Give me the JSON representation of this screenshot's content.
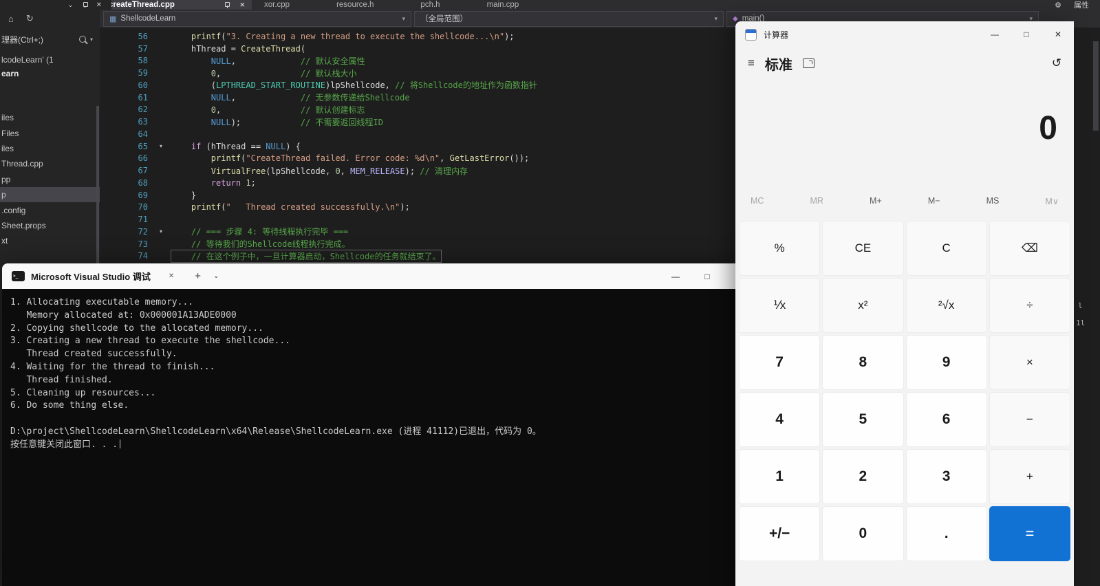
{
  "icons": {
    "chevron_down": "⌄",
    "caret": "▾",
    "close": "✕",
    "minimize": "—",
    "maximize": "□",
    "plus": "+",
    "hamburger": "≡",
    "history": "↺",
    "gear": "⚙",
    "home": "⌂",
    "refresh": "↻",
    "cmd": ">_",
    "project": "▦",
    "cube": "◆"
  },
  "vs": {
    "tabs": [
      {
        "label": "createThread.cpp",
        "active": true
      },
      {
        "label": "xor.cpp"
      },
      {
        "label": "resource.h"
      },
      {
        "label": "pch.h"
      },
      {
        "label": "main.cpp"
      }
    ],
    "top_right": {
      "properties": "属性"
    },
    "navbar": {
      "project": "ShellcodeLearn",
      "scope": "（全局范围）",
      "symbol": "main()"
    },
    "sidebar": {
      "search": "理器(Ctrl+;)",
      "solution": "lcodeLearn' (1",
      "project": "earn",
      "items": [
        {
          "label": "iles"
        },
        {
          "label": "Files"
        },
        {
          "label": "iles"
        },
        {
          "label": "Thread.cpp"
        },
        {
          "label": "pp"
        },
        {
          "label": "p",
          "selected": true
        },
        {
          "label": ".config"
        },
        {
          "label": "Sheet.props"
        },
        {
          "label": "xt"
        }
      ]
    },
    "right_strip": [
      "l",
      "1l"
    ],
    "editor": {
      "lines": [
        {
          "num": "56",
          "segs": [
            [
              "p",
              "    "
            ],
            [
              "fn",
              "printf"
            ],
            [
              "p",
              "("
            ],
            [
              "s",
              "\"3. Creating a new thread to execute the shellcode...\\n\""
            ],
            [
              "p",
              ");"
            ]
          ]
        },
        {
          "num": "57",
          "segs": [
            [
              "p",
              "    hThread = "
            ],
            [
              "fn",
              "CreateThread"
            ],
            [
              "p",
              "("
            ]
          ]
        },
        {
          "num": "58",
          "segs": [
            [
              "p",
              "        "
            ],
            [
              "k",
              "NULL"
            ],
            [
              "p",
              ",             "
            ],
            [
              "c",
              "// 默认安全属性"
            ]
          ]
        },
        {
          "num": "59",
          "segs": [
            [
              "p",
              "        "
            ],
            [
              "n",
              "0"
            ],
            [
              "p",
              ",                "
            ],
            [
              "c",
              "// 默认栈大小"
            ]
          ]
        },
        {
          "num": "60",
          "segs": [
            [
              "p",
              "        ("
            ],
            [
              "t",
              "LPTHREAD_START_ROUTINE"
            ],
            [
              "p",
              ")lpShellcode, "
            ],
            [
              "c",
              "// 将Shellcode的地址作为函数指针"
            ]
          ]
        },
        {
          "num": "61",
          "segs": [
            [
              "p",
              "        "
            ],
            [
              "k",
              "NULL"
            ],
            [
              "p",
              ",             "
            ],
            [
              "c",
              "// 无参数传递给Shellcode"
            ]
          ]
        },
        {
          "num": "62",
          "segs": [
            [
              "p",
              "        "
            ],
            [
              "n",
              "0"
            ],
            [
              "p",
              ",                "
            ],
            [
              "c",
              "// 默认创建标志"
            ]
          ]
        },
        {
          "num": "63",
          "segs": [
            [
              "p",
              "        "
            ],
            [
              "k",
              "NULL"
            ],
            [
              "p",
              ");            "
            ],
            [
              "c",
              "// 不需要返回线程ID"
            ]
          ]
        },
        {
          "num": "64",
          "segs": []
        },
        {
          "num": "65",
          "fold": true,
          "segs": [
            [
              "p",
              "    "
            ],
            [
              "ck",
              "if"
            ],
            [
              "p",
              " (hThread == "
            ],
            [
              "k",
              "NULL"
            ],
            [
              "p",
              ") {"
            ]
          ]
        },
        {
          "num": "66",
          "segs": [
            [
              "p",
              "        "
            ],
            [
              "fn",
              "printf"
            ],
            [
              "p",
              "("
            ],
            [
              "s",
              "\"CreateThread failed. Error code: %d\\n\""
            ],
            [
              "p",
              ", "
            ],
            [
              "fn",
              "GetLastError"
            ],
            [
              "p",
              "());"
            ]
          ]
        },
        {
          "num": "67",
          "segs": [
            [
              "p",
              "        "
            ],
            [
              "fn",
              "VirtualFree"
            ],
            [
              "p",
              "(lpShellcode, "
            ],
            [
              "n",
              "0"
            ],
            [
              "p",
              ", "
            ],
            [
              "m",
              "MEM_RELEASE"
            ],
            [
              "p",
              "); "
            ],
            [
              "c",
              "// 清理内存"
            ]
          ]
        },
        {
          "num": "68",
          "segs": [
            [
              "p",
              "        "
            ],
            [
              "ck",
              "return"
            ],
            [
              "p",
              " "
            ],
            [
              "n",
              "1"
            ],
            [
              "p",
              ";"
            ]
          ]
        },
        {
          "num": "69",
          "segs": [
            [
              "p",
              "    }"
            ]
          ]
        },
        {
          "num": "70",
          "segs": [
            [
              "p",
              "    "
            ],
            [
              "fn",
              "printf"
            ],
            [
              "p",
              "("
            ],
            [
              "s",
              "\"   Thread created successfully.\\n\""
            ],
            [
              "p",
              ");"
            ]
          ]
        },
        {
          "num": "71",
          "segs": []
        },
        {
          "num": "72",
          "fold": true,
          "segs": [
            [
              "p",
              "    "
            ],
            [
              "c",
              "// === 步骤 4: 等待线程执行完毕 ==="
            ]
          ]
        },
        {
          "num": "73",
          "segs": [
            [
              "p",
              "    "
            ],
            [
              "c",
              "// 等待我们的Shellcode线程执行完成。"
            ]
          ]
        },
        {
          "num": "74",
          "boxed": true,
          "segs": [
            [
              "p",
              "    "
            ],
            [
              "c",
              "// 在这个例子中，一旦计算器启动，Shellcode的任务就结束了。"
            ]
          ]
        }
      ]
    }
  },
  "console": {
    "title": "Microsoft Visual Studio 调试",
    "lines": [
      "1. Allocating executable memory...",
      "   Memory allocated at: 0x000001A13ADE0000",
      "2. Copying shellcode to the allocated memory...",
      "3. Creating a new thread to execute the shellcode...",
      "   Thread created successfully.",
      "4. Waiting for the thread to finish...",
      "   Thread finished.",
      "5. Cleaning up resources...",
      "6. Do some thing else.",
      "",
      "D:\\project\\ShellcodeLearn\\ShellcodeLearn\\x64\\Release\\ShellcodeLearn.exe (进程 41112)已退出，代码为 0。",
      "按任意键关闭此窗口. . ."
    ]
  },
  "calculator": {
    "title": "计算器",
    "mode": "标准",
    "display": "0",
    "accent": "#1272d4",
    "memory": [
      {
        "label": "MC",
        "name": "mc",
        "enabled": false
      },
      {
        "label": "MR",
        "name": "mr",
        "enabled": false
      },
      {
        "label": "M+",
        "name": "m-plus",
        "enabled": true
      },
      {
        "label": "M−",
        "name": "m-minus",
        "enabled": true
      },
      {
        "label": "MS",
        "name": "ms",
        "enabled": true
      },
      {
        "label": "M∨",
        "name": "m-dropdown",
        "enabled": false
      }
    ],
    "buttons": [
      {
        "label": "%",
        "name": "percent",
        "type": "fn"
      },
      {
        "label": "CE",
        "name": "clear-entry",
        "type": "fn"
      },
      {
        "label": "C",
        "name": "clear",
        "type": "fn"
      },
      {
        "label": "⌫",
        "name": "backspace",
        "type": "fn"
      },
      {
        "label": "⅟x",
        "name": "reciprocal",
        "type": "fn"
      },
      {
        "label": "x²",
        "name": "square",
        "type": "fn"
      },
      {
        "label": "²√x",
        "name": "square-root",
        "type": "fn"
      },
      {
        "label": "÷",
        "name": "divide",
        "type": "fn"
      },
      {
        "label": "7",
        "name": "seven",
        "type": "num"
      },
      {
        "label": "8",
        "name": "eight",
        "type": "num"
      },
      {
        "label": "9",
        "name": "nine",
        "type": "num"
      },
      {
        "label": "×",
        "name": "multiply",
        "type": "fn"
      },
      {
        "label": "4",
        "name": "four",
        "type": "num"
      },
      {
        "label": "5",
        "name": "five",
        "type": "num"
      },
      {
        "label": "6",
        "name": "six",
        "type": "num"
      },
      {
        "label": "−",
        "name": "subtract",
        "type": "fn"
      },
      {
        "label": "1",
        "name": "one",
        "type": "num"
      },
      {
        "label": "2",
        "name": "two",
        "type": "num"
      },
      {
        "label": "3",
        "name": "three",
        "type": "num"
      },
      {
        "label": "+",
        "name": "add",
        "type": "fn"
      },
      {
        "label": "+/−",
        "name": "negate",
        "type": "num"
      },
      {
        "label": "0",
        "name": "zero",
        "type": "num"
      },
      {
        "label": ".",
        "name": "decimal",
        "type": "num"
      },
      {
        "label": "=",
        "name": "equals",
        "type": "eq"
      }
    ]
  }
}
